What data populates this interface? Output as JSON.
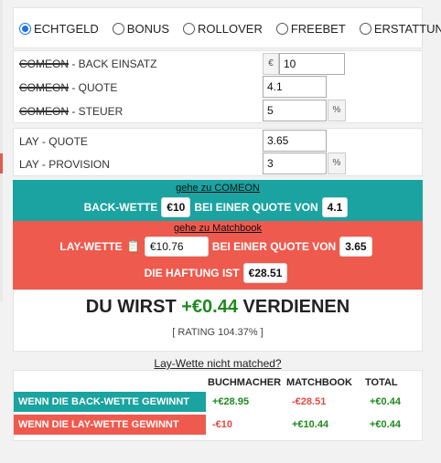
{
  "radio_options": [
    {
      "label": "ECHTGELD",
      "checked": true
    },
    {
      "label": "BONUS",
      "checked": false
    },
    {
      "label": "ROLLOVER",
      "checked": false
    },
    {
      "label": "FREEBET",
      "checked": false
    },
    {
      "label": "ERSTATTUNG",
      "checked": false
    }
  ],
  "back": {
    "einsatz_label_struck": "COMEON",
    "einsatz_label": " - BACK EINSATZ",
    "currency_symbol": "€",
    "einsatz_value": "10",
    "quote_label_struck": "COMEON",
    "quote_label": " - QUOTE",
    "quote_value": "4.1",
    "steuer_label_struck": "COMEON",
    "steuer_label": " - STEUER",
    "steuer_value": "5",
    "percent": "%"
  },
  "lay": {
    "quote_label": "LAY - QUOTE",
    "quote_value": "3.65",
    "provision_label": "LAY - PROVISION",
    "provision_value": "3",
    "percent": "%"
  },
  "back_result": {
    "link": "gehe zu COMEON",
    "prefix": "BACK-WETTE",
    "stake": "€10",
    "mid": "BEI EINER QUOTE VON",
    "odds": "4.1"
  },
  "lay_result": {
    "link": "gehe zu Matchbook",
    "prefix": "LAY-WETTE",
    "stake": "€10.76",
    "mid": "BEI EINER QUOTE VON",
    "odds": "3.65",
    "liability_label": "DIE HAFTUNG IST",
    "liability": "€28.51"
  },
  "summary": {
    "prefix": "DU WIRST ",
    "amount": "+€0.44",
    "suffix": " VERDIENEN",
    "rating": "[ RATING 104.37% ]"
  },
  "not_matched_link": "Lay-Wette nicht matched?",
  "table": {
    "headers": [
      "BUCHMACHER",
      "MATCHBOOK",
      "TOTAL"
    ],
    "rows": [
      {
        "label": "WENN DIE BACK-WETTE GEWINNT",
        "buchmacher": "+€28.95",
        "matchbook": "-€28.51",
        "total": "+€0.44"
      },
      {
        "label": "WENN DIE LAY-WETTE GEWINNT",
        "buchmacher": "-€10",
        "matchbook": "+€10.44",
        "total": "+€0.44"
      }
    ]
  },
  "colors": {
    "teal": "#1aa3a0",
    "red": "#ef5a4e",
    "positive": "#1e8a1e",
    "negative": "#e34a40",
    "radio_accent": "#1a73e8"
  }
}
